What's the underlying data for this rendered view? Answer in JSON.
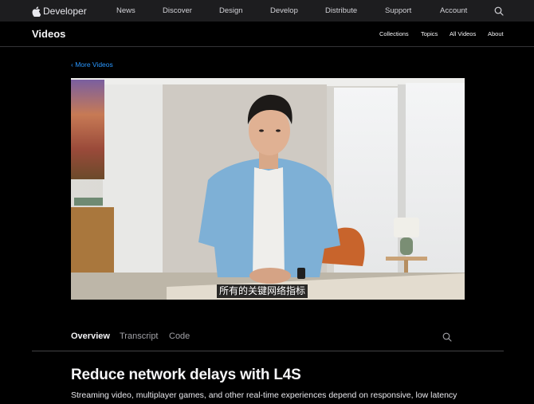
{
  "global_nav": {
    "brand": "Developer",
    "links": [
      "News",
      "Discover",
      "Design",
      "Develop",
      "Distribute",
      "Support",
      "Account"
    ]
  },
  "local_nav": {
    "title": "Videos",
    "links": [
      "Collections",
      "Topics",
      "All Videos",
      "About"
    ]
  },
  "back_link": "‹ More Videos",
  "video": {
    "subtitle": "所有的关键网络指标"
  },
  "tabs": [
    "Overview",
    "Transcript",
    "Code"
  ],
  "article": {
    "title": "Reduce network delays with L4S",
    "intro": "Streaming video, multiplayer games, and other real-time experiences depend on responsive, low latency"
  },
  "colors": {
    "background": "#000000",
    "nav_background": "#1d1d1f",
    "link_blue": "#2997ff",
    "text_primary": "#f5f5f7",
    "text_secondary": "#a1a1a6"
  }
}
